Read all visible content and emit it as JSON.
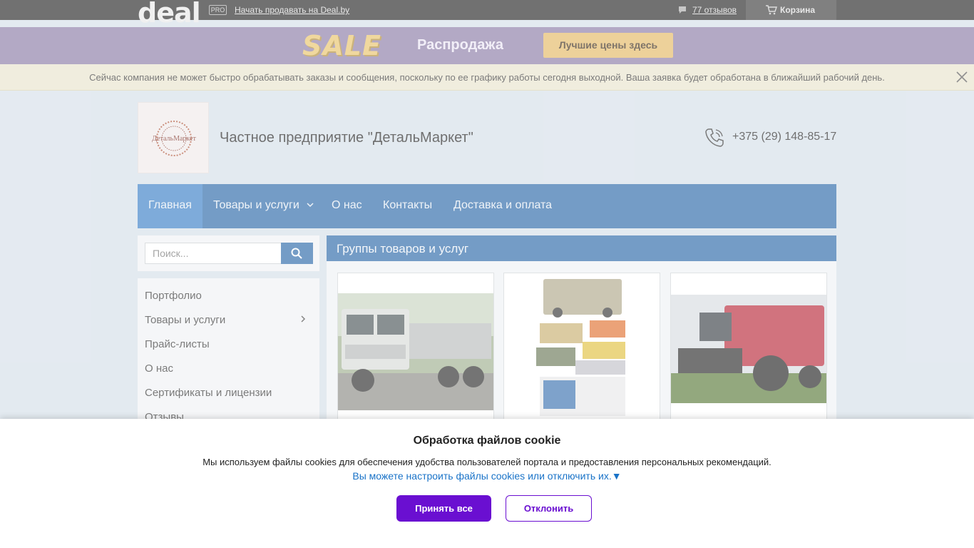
{
  "topbar": {
    "logo": "deal",
    "pro_badge": "PRO",
    "sell_link": "Начать продавать на Deal.by",
    "reviews_link": "77 отзывов",
    "cart_label": "Корзина"
  },
  "sale_banner": {
    "sale_word": "SALE",
    "title": "Распродажа",
    "button_label": "Лучшие цены здесь"
  },
  "notice": {
    "text": "Сейчас компания не может быстро обрабатывать заказы и сообщения, поскольку по ее графику работы сегодня выходной. Ваша заявка будет обработана в ближайший рабочий день."
  },
  "header": {
    "logo_text": "ДетальМаркет",
    "company_name": "Частное предприятие \"ДетальМаркет\"",
    "phone": "+375 (29) 148-85-17"
  },
  "nav": {
    "items": [
      {
        "label": "Главная"
      },
      {
        "label": "Товары и услуги"
      },
      {
        "label": "О нас"
      },
      {
        "label": "Контакты"
      },
      {
        "label": "Доставка и оплата"
      }
    ]
  },
  "sidebar": {
    "search_placeholder": "Поиск...",
    "menu": [
      {
        "label": "Портфолио"
      },
      {
        "label": "Товары и услуги"
      },
      {
        "label": "Прайс-листы"
      },
      {
        "label": "О нас"
      },
      {
        "label": "Сертификаты и лицензии"
      },
      {
        "label": "Отзывы"
      }
    ]
  },
  "groups": {
    "title": "Группы товаров и услуг"
  },
  "cookie": {
    "title": "Обработка файлов cookie",
    "text": "Мы используем файлы cookies для обеспечения удобства пользователей портала и предоставления персональных рекомендаций.",
    "settings_link": "Вы можете настроить файлы cookies или отключить их.▼",
    "accept_label": "Принять все",
    "decline_label": "Отклонить"
  },
  "colors": {
    "nav_blue": "#2a67a8",
    "accept_purple": "#6a0fd1",
    "sale_gold": "#e4b964"
  }
}
